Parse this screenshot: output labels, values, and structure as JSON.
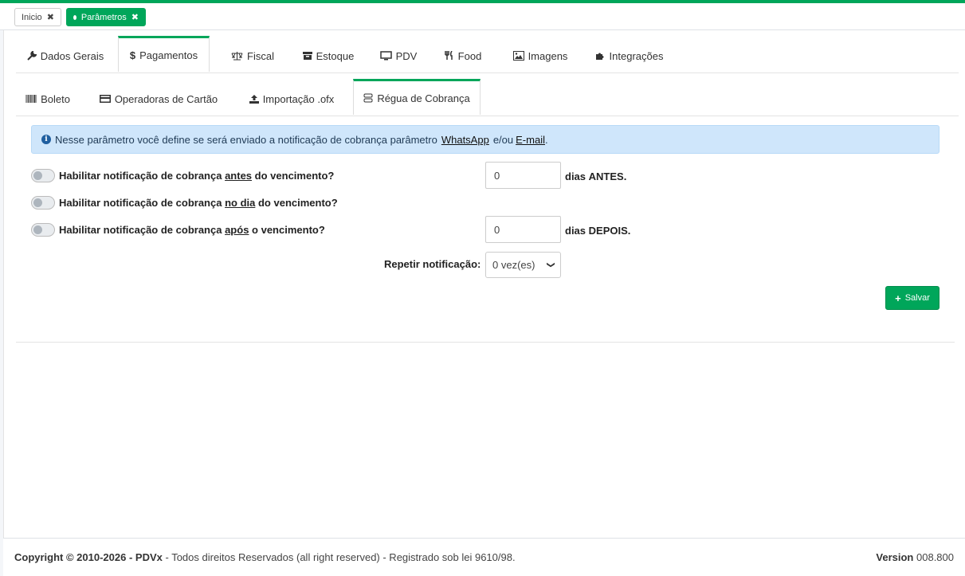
{
  "top_tabs": [
    {
      "label": "Inicio",
      "close": "✖"
    },
    {
      "label": "Parâmetros",
      "close": "✖"
    }
  ],
  "main_tabs": [
    {
      "label": "Dados Gerais",
      "icon": "wrench-icon"
    },
    {
      "label": "Pagamentos",
      "icon": "dollar-icon"
    },
    {
      "label": "Fiscal",
      "icon": "balance-scale-icon"
    },
    {
      "label": "Estoque",
      "icon": "archive-icon"
    },
    {
      "label": "PDV",
      "icon": "monitor-icon"
    },
    {
      "label": "Food",
      "icon": "utensils-icon"
    },
    {
      "label": "Imagens",
      "icon": "image-icon"
    },
    {
      "label": "Integrações",
      "icon": "puzzle-icon"
    }
  ],
  "sub_tabs": [
    {
      "label": "Boleto",
      "icon": "barcode-icon"
    },
    {
      "label": "Operadoras de Cartão",
      "icon": "credit-card-icon"
    },
    {
      "label": "Importação .ofx",
      "icon": "upload-icon"
    },
    {
      "label": "Régua de Cobrança",
      "icon": "database-icon"
    }
  ],
  "alert": {
    "text_before": "Nesse parâmetro você define se será enviado a notificação de cobrança parâmetro",
    "link1": "WhatsApp",
    "middle": "e/ou",
    "link2": "E-mail",
    "end": "."
  },
  "options": {
    "before": {
      "pre": "Habilitar notificação de cobrança",
      "emph": "antes",
      "post": "do vencimento?",
      "value": "0",
      "suffix_pre": "dias",
      "suffix_emph": "ANTES."
    },
    "same_day": {
      "pre": "Habilitar notificação de cobrança",
      "emph": "no dia",
      "post": "do vencimento?"
    },
    "after": {
      "pre": "Habilitar notificação de cobrança",
      "emph": "após",
      "post": "o vencimento?",
      "value": "0",
      "suffix_pre": "dias",
      "suffix_emph": "DEPOIS."
    }
  },
  "repeat": {
    "label": "Repetir notificação:",
    "selected": "0 vez(es)"
  },
  "save_button": "Salvar",
  "footer": {
    "copyright_bold": "Copyright © 2010-2026 - PDVx",
    "copyright_rest": " - Todos direitos Reservados (all right reserved) - Registrado sob lei 9610/98.",
    "version_label": "Version",
    "version_value": "008.800"
  },
  "colors": {
    "accent": "#00a65a",
    "alert_bg": "#cfe6fb"
  }
}
